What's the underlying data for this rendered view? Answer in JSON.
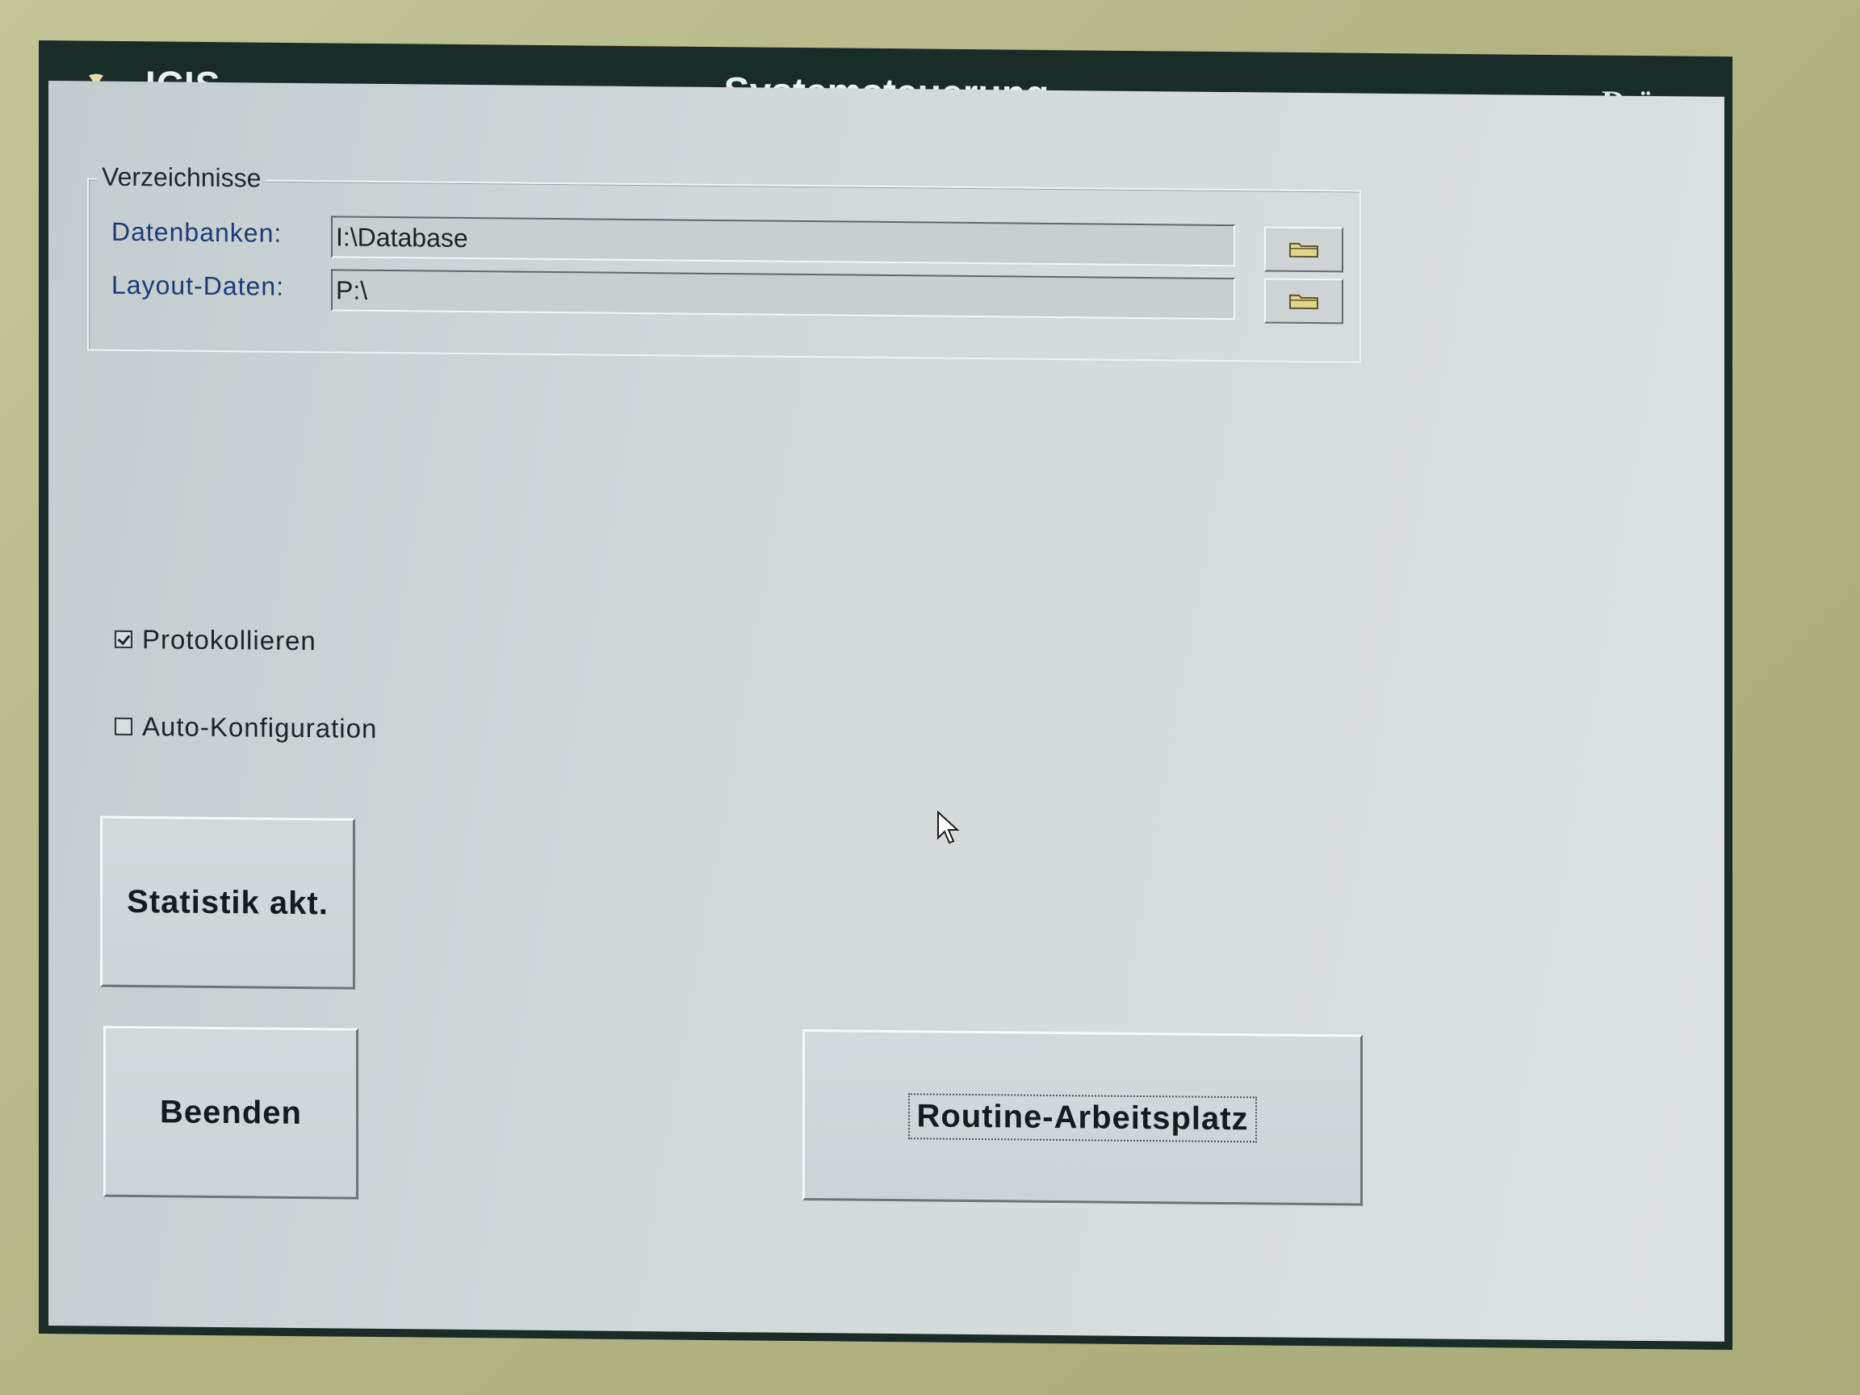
{
  "titlebar": {
    "app_name": "ICIS",
    "window_title": "Systemsteuerung",
    "brand": "Dräger",
    "app_icon": "info-pin-icon"
  },
  "directories": {
    "legend": "Verzeichnisse",
    "databases_label": "Datenbanken:",
    "databases_value": "I:\\Database",
    "layout_label": "Layout-Daten:",
    "layout_value": "P:\\",
    "browse_icon": "folder-icon"
  },
  "options": {
    "log_label": "Protokollieren",
    "log_checked": true,
    "auto_config_label": "Auto-Konfiguration",
    "auto_config_checked": false
  },
  "buttons": {
    "statistics": "Statistik akt.",
    "exit": "Beenden",
    "routine_workstation": "Routine-Arbeitsplatz"
  },
  "colors": {
    "titlebar": "#1a2c29",
    "screen_bg": "#d1d7d9",
    "label_blue": "#1a3c78"
  }
}
